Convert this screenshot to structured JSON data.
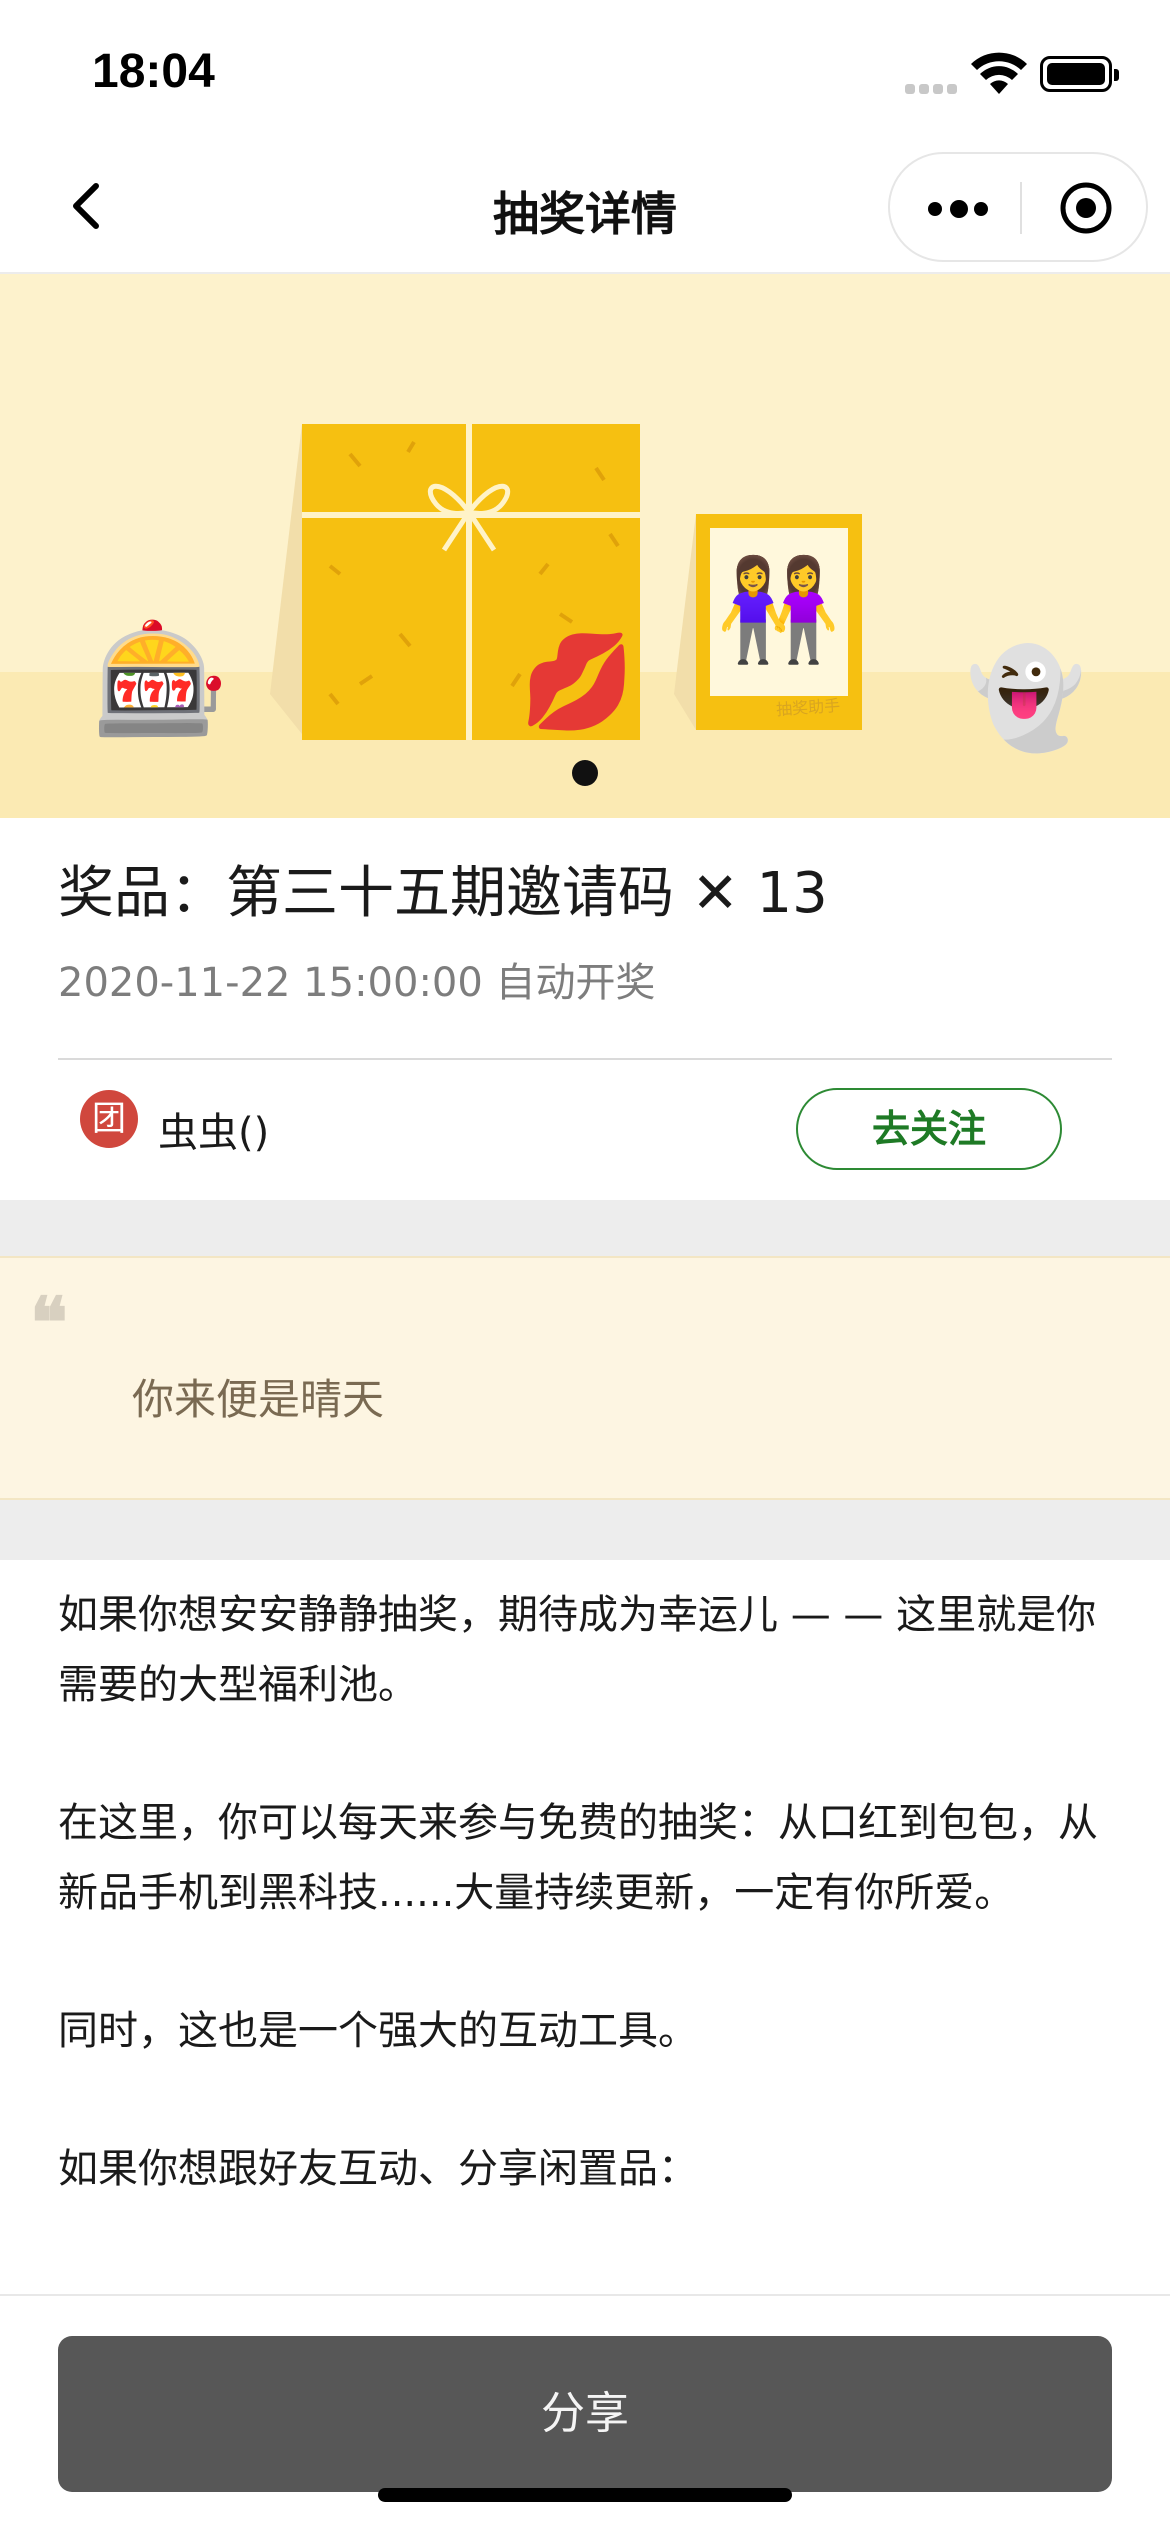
{
  "status_bar": {
    "time": "18:04"
  },
  "nav": {
    "title": "抽奖详情"
  },
  "banner": {
    "emojis": {
      "slot_machine": "🎰",
      "kiss_mark": "💋",
      "two_women": "👭",
      "ghost": "👻"
    },
    "photo_caption": "抽奖助手",
    "slide_count": 1,
    "active_slide": 1
  },
  "prize": {
    "title": "奖品：第三十五期邀请码 ✕ 13",
    "draw_time": "2020-11-22 15:00:00 自动开奖"
  },
  "sponsor": {
    "avatar_text": "团",
    "name": "虫虫()",
    "follow_label": "去关注"
  },
  "quote": {
    "mark": "❝",
    "text": "你来便是晴天"
  },
  "description": {
    "paragraphs": [
      "如果你想安安静静抽奖，期待成为幸运儿 — — 这里就是你需要的大型福利池。",
      "在这里，你可以每天来参与免费的抽奖：从口红到包包，从新品手机到黑科技......大量持续更新，一定有你所爱。",
      "同时，这也是一个强大的互动工具。",
      "如果你想跟好友互动、分享闲置品："
    ]
  },
  "bottom": {
    "share_label": "分享"
  },
  "colors": {
    "banner_bg": "#fdf2cc",
    "gift_yellow": "#f6c011",
    "follow_green": "#1e7a25",
    "share_button": "#575757",
    "avatar_red": "#d0473d"
  }
}
